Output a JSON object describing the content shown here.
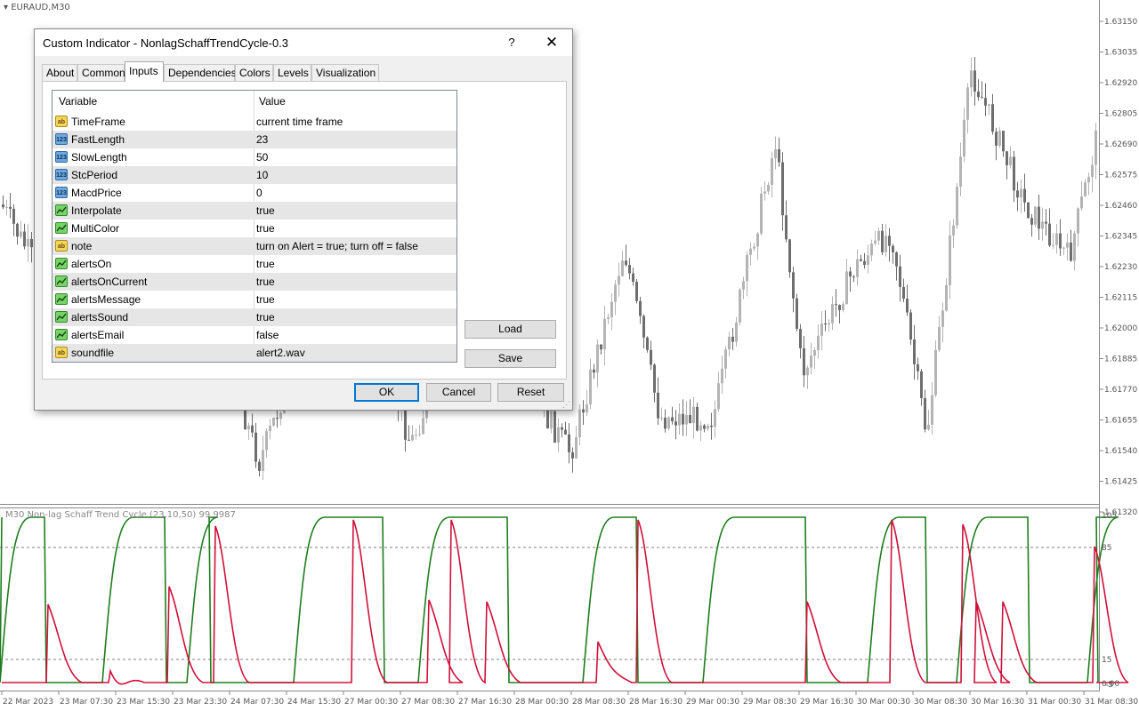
{
  "chart": {
    "symbol_label": "EURAUD,M30",
    "indicator_label": "M30 Non-lag Schaff Trend Cycle  (23,10,50) 99.9987",
    "price_ticks": [
      "1.63150",
      "1.63035",
      "1.62920",
      "1.62805",
      "1.62690",
      "1.62575",
      "1.62460",
      "1.62345",
      "1.62230",
      "1.62115",
      "1.62000",
      "1.61885",
      "1.61770",
      "1.61655",
      "1.61540",
      "1.61425",
      "1.61320"
    ],
    "indicator_ticks": [
      "105",
      "85",
      "15",
      "0.00"
    ],
    "indicator_tick_values": [
      105,
      85,
      15,
      0
    ],
    "indicator_extra_tick": "-5",
    "time_ticks": [
      "22 Mar 2023",
      "23 Mar 07:30",
      "23 Mar 15:30",
      "23 Mar 23:30",
      "24 Mar 07:30",
      "24 Mar 15:30",
      "27 Mar 00:30",
      "27 Mar 08:30",
      "27 Mar 16:30",
      "28 Mar 00:30",
      "28 Mar 08:30",
      "28 Mar 16:30",
      "29 Mar 00:30",
      "29 Mar 08:30",
      "29 Mar 16:30",
      "30 Mar 00:30",
      "30 Mar 08:30",
      "30 Mar 16:30",
      "31 Mar 00:30",
      "31 Mar 08:30"
    ],
    "colors": {
      "up_candle": "#b4b4b4",
      "down_candle": "#6e6e6e",
      "stc_green": "#1e7d1e",
      "stc_red": "#d0103a",
      "level_line": "#555555"
    }
  },
  "dialog": {
    "title": "Custom Indicator - NonlagSchaffTrendCycle-0.3",
    "help_label": "?",
    "close_label": "✕",
    "tabs": [
      {
        "label": "About"
      },
      {
        "label": "Common"
      },
      {
        "label": "Inputs"
      },
      {
        "label": "Dependencies"
      },
      {
        "label": "Colors"
      },
      {
        "label": "Levels"
      },
      {
        "label": "Visualization"
      }
    ],
    "active_tab": "Inputs",
    "columns": {
      "variable": "Variable",
      "value": "Value"
    },
    "inputs": [
      {
        "type": "ab",
        "type_label": "ab",
        "icon": "string-icon",
        "variable": "TimeFrame",
        "value": "current time frame"
      },
      {
        "type": "num",
        "type_label": "123",
        "icon": "int-icon",
        "variable": "FastLength",
        "value": "23"
      },
      {
        "type": "num",
        "type_label": "123",
        "icon": "int-icon",
        "variable": "SlowLength",
        "value": "50"
      },
      {
        "type": "num",
        "type_label": "123",
        "icon": "int-icon",
        "variable": "StcPeriod",
        "value": "10"
      },
      {
        "type": "num",
        "type_label": "123",
        "icon": "int-icon",
        "variable": "MacdPrice",
        "value": "0"
      },
      {
        "type": "bool",
        "type_label": "",
        "icon": "bool-icon",
        "variable": "Interpolate",
        "value": "true"
      },
      {
        "type": "bool",
        "type_label": "",
        "icon": "bool-icon",
        "variable": "MultiColor",
        "value": "true"
      },
      {
        "type": "ab",
        "type_label": "ab",
        "icon": "string-icon",
        "variable": "note",
        "value": "turn on Alert = true; turn off = false"
      },
      {
        "type": "bool",
        "type_label": "",
        "icon": "bool-icon",
        "variable": "alertsOn",
        "value": "true"
      },
      {
        "type": "bool",
        "type_label": "",
        "icon": "bool-icon",
        "variable": "alertsOnCurrent",
        "value": "true"
      },
      {
        "type": "bool",
        "type_label": "",
        "icon": "bool-icon",
        "variable": "alertsMessage",
        "value": "true"
      },
      {
        "type": "bool",
        "type_label": "",
        "icon": "bool-icon",
        "variable": "alertsSound",
        "value": "true"
      },
      {
        "type": "bool",
        "type_label": "",
        "icon": "bool-icon",
        "variable": "alertsEmail",
        "value": "false"
      },
      {
        "type": "ab",
        "type_label": "ab",
        "icon": "string-icon",
        "variable": "soundfile",
        "value": "alert2.wav"
      }
    ],
    "load_label": "Load",
    "save_label": "Save",
    "ok_label": "OK",
    "cancel_label": "Cancel",
    "reset_label": "Reset"
  }
}
